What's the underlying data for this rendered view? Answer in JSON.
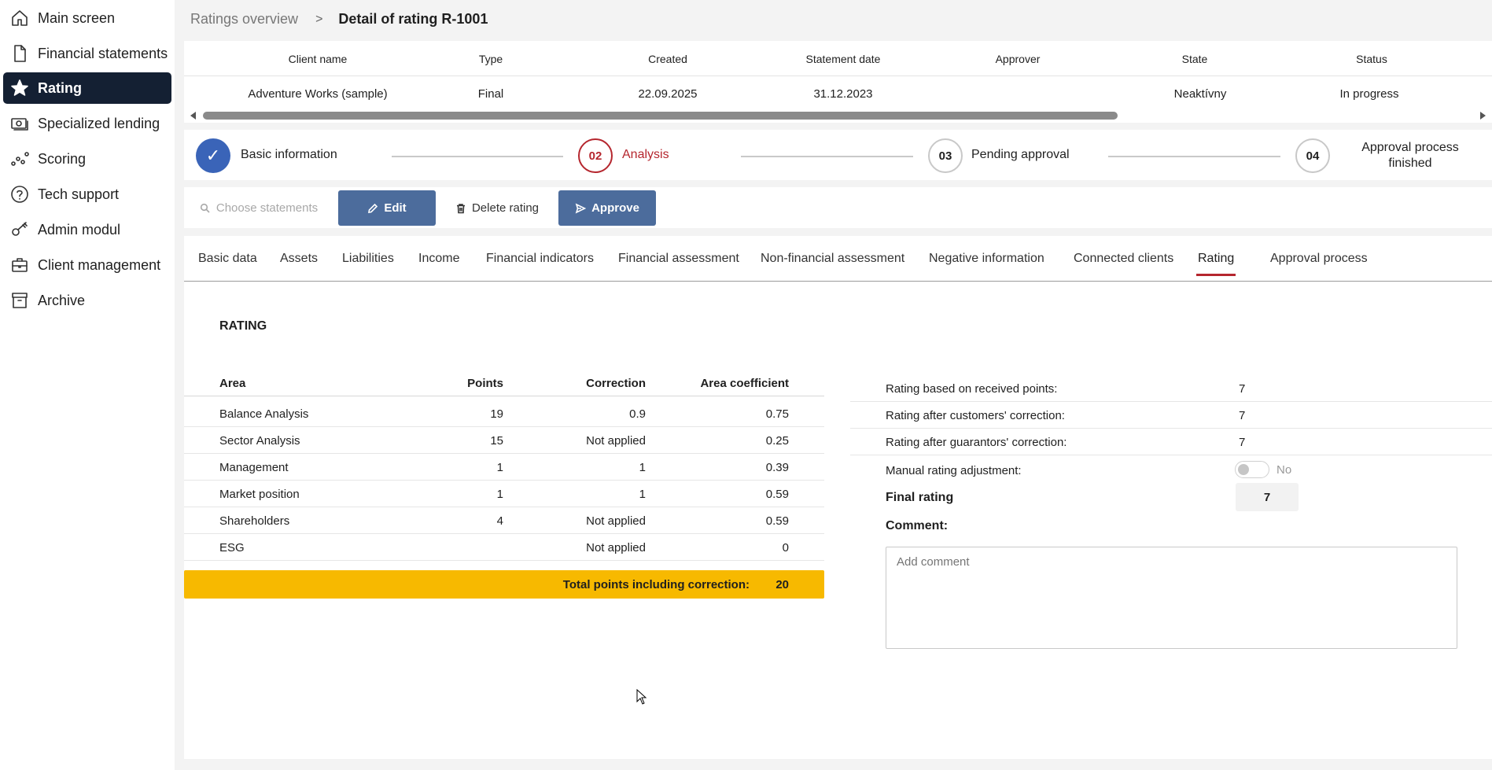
{
  "sidebar": {
    "items": [
      {
        "label": "Main screen",
        "icon": "home-icon"
      },
      {
        "label": "Financial statements",
        "icon": "document-icon"
      },
      {
        "label": "Rating",
        "icon": "star-icon",
        "active": true
      },
      {
        "label": "Specialized lending",
        "icon": "money-icon"
      },
      {
        "label": "Scoring",
        "icon": "bar-chart-icon"
      },
      {
        "label": "Tech support",
        "icon": "help-icon"
      },
      {
        "label": "Admin modul",
        "icon": "key-icon"
      },
      {
        "label": "Client management",
        "icon": "briefcase-icon"
      },
      {
        "label": "Archive",
        "icon": "archive-icon"
      }
    ]
  },
  "breadcrumb": {
    "parent": "Ratings overview",
    "separator": ">",
    "current": "Detail of rating R-1001"
  },
  "header_table": {
    "columns": [
      "Client name",
      "Type",
      "Created",
      "Statement date",
      "Approver",
      "State",
      "Status"
    ],
    "row": [
      "Adventure Works (sample)",
      "Final",
      "22.09.2025",
      "31.12.2023",
      "",
      "Neaktívny",
      "In progress"
    ]
  },
  "steps": [
    {
      "number": "✓",
      "label": "Basic information",
      "state": "done"
    },
    {
      "number": "02",
      "label": "Analysis",
      "state": "active"
    },
    {
      "number": "03",
      "label": "Pending approval",
      "state": "pending"
    },
    {
      "number": "04",
      "label": "Approval process finished",
      "state": "pending"
    }
  ],
  "toolbar": {
    "choose_label": "Choose statements",
    "edit_label": "Edit",
    "delete_label": "Delete rating",
    "approve_label": "Approve"
  },
  "tabs": [
    "Basic data",
    "Assets",
    "Liabilities",
    "Income",
    "Financial indicators",
    "Financial assessment",
    "Non-financial assessment",
    "Negative information",
    "Connected clients",
    "Rating",
    "Approval process"
  ],
  "active_tab": "Rating",
  "rating": {
    "title": "RATING",
    "columns": {
      "area": "Area",
      "points": "Points",
      "correction": "Correction",
      "coefficient": "Area coefficient"
    },
    "rows": [
      {
        "area": "Balance Analysis",
        "points": "19",
        "correction": "0.9",
        "coefficient": "0.75"
      },
      {
        "area": "Sector Analysis",
        "points": "15",
        "correction": "Not applied",
        "coefficient": "0.25"
      },
      {
        "area": "Management",
        "points": "1",
        "correction": "1",
        "coefficient": "0.39"
      },
      {
        "area": "Market position",
        "points": "1",
        "correction": "1",
        "coefficient": "0.59"
      },
      {
        "area": "Shareholders",
        "points": "4",
        "correction": "Not applied",
        "coefficient": "0.59"
      },
      {
        "area": "ESG",
        "points": "",
        "correction": "Not applied",
        "coefficient": "0"
      }
    ],
    "total_label": "Total points including correction:",
    "total_value": "20"
  },
  "summary": {
    "based_on_points_label": "Rating based on received points:",
    "based_on_points_value": "7",
    "after_customers_label": "Rating after customers' correction:",
    "after_customers_value": "7",
    "after_guarantors_label": "Rating after guarantors' correction:",
    "after_guarantors_value": "7",
    "manual_adjust_label": "Manual rating adjustment:",
    "manual_adjust_value": "No",
    "final_label": "Final rating",
    "final_value": "7",
    "comment_label": "Comment:",
    "comment_placeholder": "Add comment"
  },
  "colors": {
    "sidebar_active": "#142033",
    "primary_button": "#4c6c9c",
    "step_done": "#3a64b8",
    "accent_red": "#b5262e",
    "total_bar": "#f7b900"
  }
}
